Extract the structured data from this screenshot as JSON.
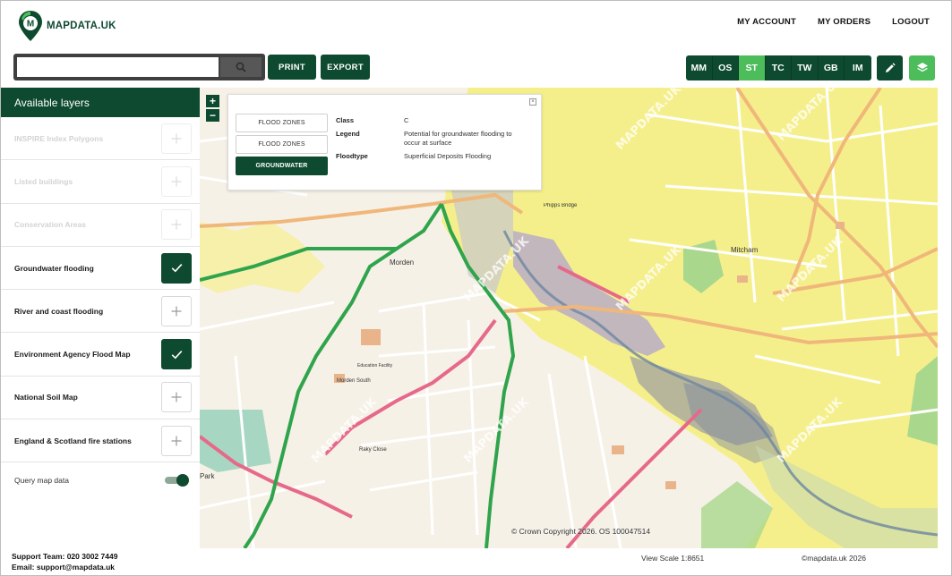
{
  "header": {
    "brand": "MAPDATA.UK",
    "nav": [
      "MY ACCOUNT",
      "MY ORDERS",
      "LOGOUT"
    ]
  },
  "toolbar": {
    "search_value": "",
    "print_label": "PRINT",
    "export_label": "EXPORT",
    "basemaps": [
      {
        "code": "MM",
        "active": false
      },
      {
        "code": "OS",
        "active": false
      },
      {
        "code": "ST",
        "active": true
      },
      {
        "code": "TC",
        "active": false
      },
      {
        "code": "TW",
        "active": false
      },
      {
        "code": "GB",
        "active": false
      },
      {
        "code": "IM",
        "active": false
      }
    ],
    "accent_color": "#0d4a2f",
    "active_color": "#4dbd5c"
  },
  "sidebar": {
    "title": "Available layers",
    "layers": [
      {
        "label": "INSPIRE Index Polygons",
        "state": "disabled"
      },
      {
        "label": "Listed buildings",
        "state": "disabled"
      },
      {
        "label": "Conservation Areas",
        "state": "disabled"
      },
      {
        "label": "Groundwater flooding",
        "state": "checked"
      },
      {
        "label": "River and coast flooding",
        "state": "unchecked"
      },
      {
        "label": "Environment Agency Flood Map",
        "state": "checked"
      },
      {
        "label": "National Soil Map",
        "state": "unchecked"
      },
      {
        "label": "England & Scotland fire stations",
        "state": "unchecked"
      }
    ],
    "query_label": "Query map data",
    "query_enabled": true
  },
  "map": {
    "zoom_in": "+",
    "zoom_out": "−",
    "popup": {
      "tabs": [
        {
          "label": "FLOOD ZONES",
          "active": false
        },
        {
          "label": "FLOOD ZONES",
          "active": false
        },
        {
          "label": "GROUNDWATER",
          "active": true
        }
      ],
      "fields": [
        {
          "key": "Class",
          "value": "C"
        },
        {
          "key": "Legend",
          "value": "Potential for groundwater flooding to occur at surface"
        },
        {
          "key": "Floodtype",
          "value": "Superficial Deposits Flooding"
        }
      ]
    },
    "places": [
      "Morden",
      "Mitcham",
      "Phipps Bridge",
      "Morden South",
      "Raky Close",
      "Park",
      "Education Facility"
    ],
    "watermark": "MAPDATA.UK",
    "copyright": "© Crown Copyright 2026. OS 100047514"
  },
  "footer": {
    "support_team": "Support Team: 020 3002 7449",
    "email": "Email: support@mapdata.uk",
    "view_scale": "View Scale 1:8651",
    "copyright": "©mapdata.uk 2026"
  }
}
